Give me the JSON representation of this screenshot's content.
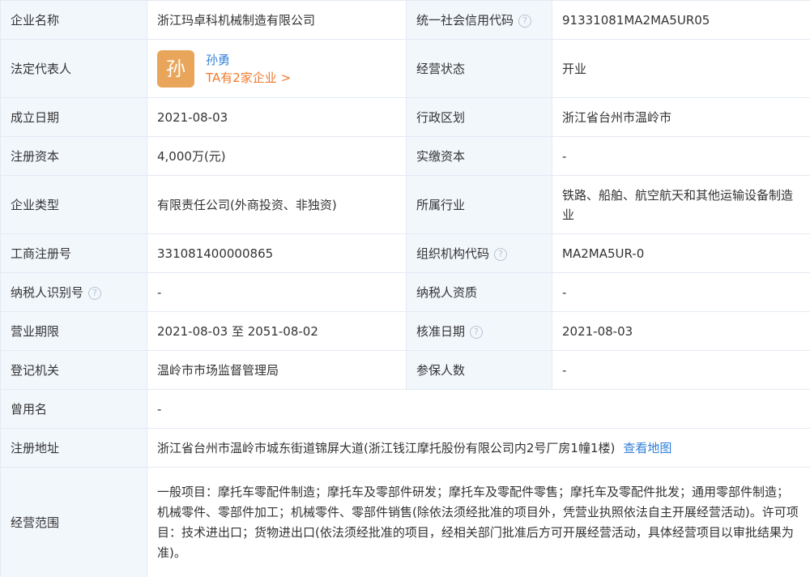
{
  "colors": {
    "label_bg": "#f2f7fc",
    "border": "#e4eaf3",
    "link_blue": "#2f7fd8",
    "link_orange": "#f07a2c",
    "avatar_bg": "#e9a65b"
  },
  "rows": {
    "company_name": {
      "label": "企业名称",
      "value": "浙江玛卓科机械制造有限公司"
    },
    "credit_code": {
      "label": "统一社会信用代码",
      "value": "91331081MA2MA5UR05",
      "help_icon": "question-circle-icon"
    },
    "legal_rep": {
      "label": "法定代表人",
      "avatar_char": "孙",
      "name": "孙勇",
      "link": "TA有2家企业 >"
    },
    "status": {
      "label": "经营状态",
      "value": "开业"
    },
    "founded": {
      "label": "成立日期",
      "value": "2021-08-03"
    },
    "district": {
      "label": "行政区划",
      "value": "浙江省台州市温岭市"
    },
    "reg_capital": {
      "label": "注册资本",
      "value": "4,000万(元)"
    },
    "paid_capital": {
      "label": "实缴资本",
      "value": "-"
    },
    "company_type": {
      "label": "企业类型",
      "value": "有限责任公司(外商投资、非独资)"
    },
    "industry": {
      "label": "所属行业",
      "value": "铁路、船舶、航空航天和其他运输设备制造业"
    },
    "reg_number": {
      "label": "工商注册号",
      "value": "331081400000865"
    },
    "org_code": {
      "label": "组织机构代码",
      "value": "MA2MA5UR-0"
    },
    "taxpayer_id": {
      "label": "纳税人识别号",
      "value": "-"
    },
    "taxpayer_qual": {
      "label": "纳税人资质",
      "value": "-"
    },
    "business_term": {
      "label": "营业期限",
      "value": "2021-08-03 至 2051-08-02"
    },
    "approval_date": {
      "label": "核准日期",
      "value": "2021-08-03"
    },
    "registry": {
      "label": "登记机关",
      "value": "温岭市市场监督管理局"
    },
    "insured": {
      "label": "参保人数",
      "value": "-"
    },
    "former_name": {
      "label": "曾用名",
      "value": "-"
    },
    "address": {
      "label": "注册地址",
      "value": "浙江省台州市温岭市城东街道锦屏大道(浙江钱江摩托股份有限公司内2号厂房1幢1楼)",
      "map_link": "查看地图"
    },
    "scope": {
      "label": "经营范围",
      "value": "一般项目：摩托车零配件制造；摩托车及零部件研发；摩托车及零配件零售；摩托车及零配件批发；通用零部件制造；机械零件、零部件加工；机械零件、零部件销售(除依法须经批准的项目外，凭营业执照依法自主开展经营活动)。许可项目：技术进出口；货物进出口(依法须经批准的项目，经相关部门批准后方可开展经营活动，具体经营项目以审批结果为准)。"
    }
  }
}
